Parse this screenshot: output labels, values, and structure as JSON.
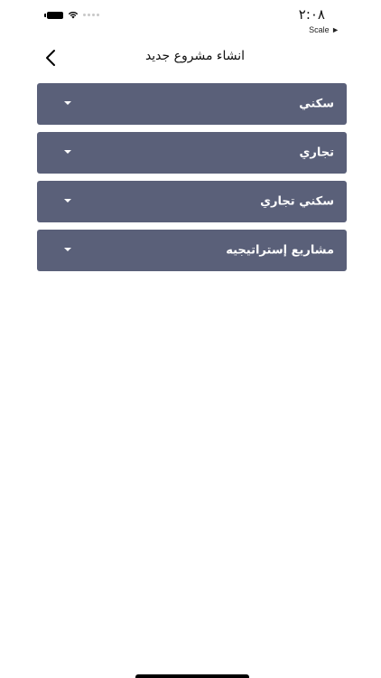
{
  "status_bar": {
    "time": "٢:٠٨",
    "scale_label": "Scale ►"
  },
  "header": {
    "title": "انشاء مشروع جديد"
  },
  "dropdowns": [
    {
      "label": "سكني"
    },
    {
      "label": "تجاري"
    },
    {
      "label": "سكني تجاري"
    },
    {
      "label": "مشاريع إستراتيجيه"
    }
  ],
  "colors": {
    "dropdown_background": "#5a6079",
    "dropdown_text": "#ffffff",
    "page_background": "#ffffff"
  }
}
